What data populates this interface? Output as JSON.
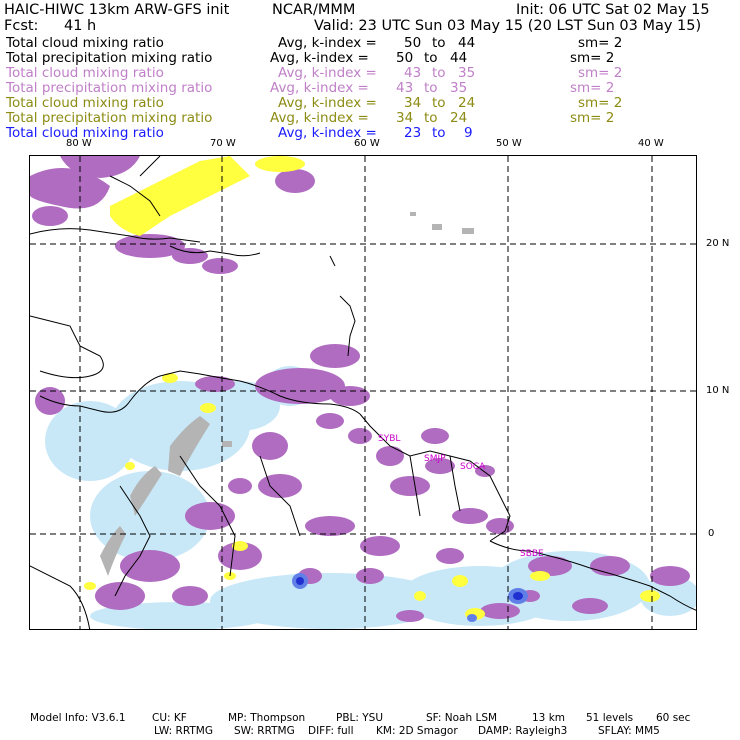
{
  "header": {
    "model": "HAIC-HIWC 13km ARW-GFS init",
    "org": "NCAR/MMM",
    "init": "Init: 06 UTC Sat 02 May 15",
    "fcst_label": "Fcst:",
    "fcst_value": "41 h",
    "valid": "Valid: 23 UTC Sun 03 May 15 (20 LST Sun 03 May 15)"
  },
  "legend": [
    {
      "name": "Total cloud mixing ratio",
      "avg": "Avg, k-index =",
      "k_from": "50",
      "to": "to",
      "k_to": "44",
      "sm": "sm= 2",
      "color": "#000000"
    },
    {
      "name": "Total precipitation mixing ratio",
      "avg": "Avg, k-index =",
      "k_from": "50",
      "to": "to",
      "k_to": "44",
      "sm": "sm= 2",
      "color": "#000000"
    },
    {
      "name": "Total cloud mixing ratio",
      "avg": "Avg, k-index =",
      "k_from": "43",
      "to": "to",
      "k_to": "35",
      "sm": "sm= 2",
      "color": "#c080c8"
    },
    {
      "name": "Total precipitation mixing ratio",
      "avg": "Avg, k-index =",
      "k_from": "43",
      "to": "to",
      "k_to": "35",
      "sm": "sm= 2",
      "color": "#c080c8"
    },
    {
      "name": "Total cloud mixing ratio",
      "avg": "Avg, k-index =",
      "k_from": "34",
      "to": "to",
      "k_to": "24",
      "sm": "sm= 2",
      "color": "#8c8c14"
    },
    {
      "name": "Total precipitation mixing ratio",
      "avg": "Avg, k-index =",
      "k_from": "34",
      "to": "to",
      "k_to": "24",
      "sm": "sm= 2",
      "color": "#8c8c14"
    },
    {
      "name": "Total cloud mixing ratio",
      "avg": "Avg, k-index =",
      "k_from": "23",
      "to": "to",
      "k_to": "9",
      "sm": "",
      "color": "#1a1aff"
    }
  ],
  "axes": {
    "lon_ticks": [
      "80 W",
      "70 W",
      "60 W",
      "50 W",
      "40 W"
    ],
    "lat_ticks": [
      "20 N",
      "10 N",
      "0"
    ]
  },
  "stations": [
    "SYBL",
    "SMJP",
    "SOCA",
    "SBBE"
  ],
  "colors": {
    "cloud_purple": "#b06cc0",
    "precip_yellow": "#ffff40",
    "light_blue": "#c8e8f8",
    "grey": "#b4b4b4",
    "deep_blue": "#2030d0",
    "station_label": "#cc00cc"
  },
  "footer": {
    "line1": [
      "Model Info: V3.6.1",
      "CU: KF",
      "MP: Thompson",
      "PBL: YSU",
      "SF: Noah LSM",
      "13 km",
      "51 levels",
      "60 sec"
    ],
    "line2": [
      "LW: RRTMG",
      "SW: RRTMG",
      "DIFF: full",
      "KM: 2D Smagor",
      "DAMP: Rayleigh3",
      "SFLAY: MM5"
    ]
  }
}
